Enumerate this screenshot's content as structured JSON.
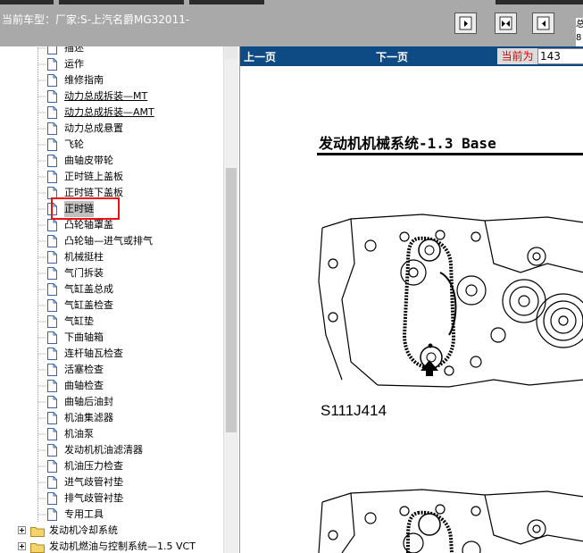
{
  "header": {
    "title_label": "当前车型：",
    "title_value": "厂家:S-上汽名爵MG32011-",
    "corner_text": "总 8"
  },
  "tree": {
    "items": [
      {
        "label": "描述"
      },
      {
        "label": "运作"
      },
      {
        "label": "维修指南"
      },
      {
        "label": "动力总成拆装—MT"
      },
      {
        "label": "动力总成拆装—AMT"
      },
      {
        "label": "动力总成悬置"
      },
      {
        "label": "飞轮"
      },
      {
        "label": "曲轴皮带轮"
      },
      {
        "label": "正时链上盖板"
      },
      {
        "label": "正时链下盖板"
      },
      {
        "label": "正时链"
      },
      {
        "label": "凸轮轴罩盖"
      },
      {
        "label": "凸轮轴—进气或排气"
      },
      {
        "label": "机械挺柱"
      },
      {
        "label": "气门拆装"
      },
      {
        "label": "气缸盖总成"
      },
      {
        "label": "气缸盖检查"
      },
      {
        "label": "气缸垫"
      },
      {
        "label": "下曲轴箱"
      },
      {
        "label": "连杆轴瓦检查"
      },
      {
        "label": "活塞检查"
      },
      {
        "label": "曲轴检查"
      },
      {
        "label": "曲轴后油封"
      },
      {
        "label": "机油集滤器"
      },
      {
        "label": "机油泵"
      },
      {
        "label": "发动机机油滤清器"
      },
      {
        "label": "机油压力检查"
      },
      {
        "label": "进气歧管衬垫"
      },
      {
        "label": "排气歧管衬垫"
      },
      {
        "label": "专用工具"
      }
    ],
    "folders": [
      {
        "label": "发动机冷却系统"
      },
      {
        "label": "发动机燃油与控制系统—1.5 VCT"
      }
    ],
    "selected_label": "正时链"
  },
  "viewer": {
    "prev_label": "上一页",
    "next_label": "下一页",
    "current_label": "当前为",
    "current_page": "143",
    "doc_title": "发动机机械系统-1.3 Base",
    "figure_label": "S111J414"
  },
  "colors": {
    "header_bg": "#a9a9a9",
    "nav_bar": "#0e4a84",
    "highlight": "#e11111",
    "current_label": "#dd0000"
  },
  "icons": {
    "doc": "page-icon",
    "folder": "folder-icon",
    "expand": "plus-box-icon"
  }
}
